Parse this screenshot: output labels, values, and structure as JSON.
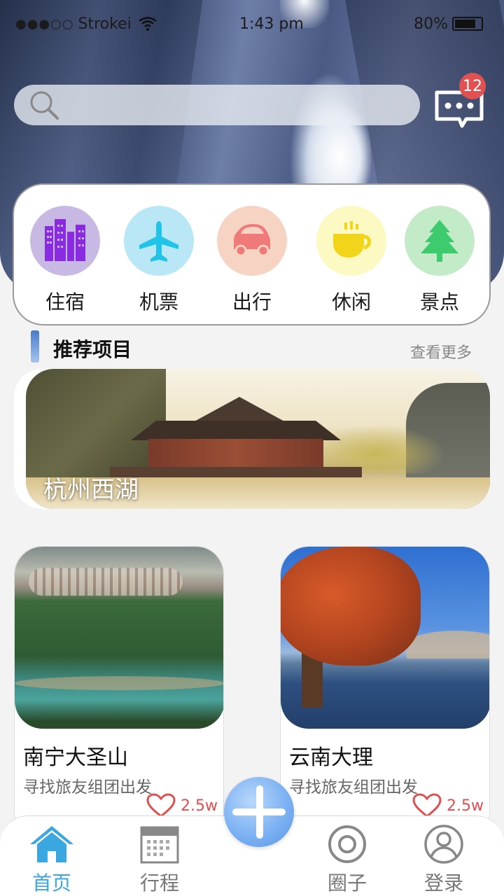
{
  "status_bar": {
    "signal": "●●●○○",
    "carrier": "Strokei",
    "time": "1:43 pm",
    "battery": "80%"
  },
  "search": {
    "placeholder": ""
  },
  "messages": {
    "badge": "12"
  },
  "categories": [
    {
      "label": "住宿",
      "icon": "building-icon",
      "bg": "#c7b8e4",
      "color": "#8a2be2"
    },
    {
      "label": "机票",
      "icon": "airplane-icon",
      "bg": "#b9e7f5",
      "color": "#1fc4e8"
    },
    {
      "label": "出行",
      "icon": "car-icon",
      "bg": "#f7d3c3",
      "color": "#f07a7a"
    },
    {
      "label": "休闲",
      "icon": "coffee-icon",
      "bg": "#fcf9c2",
      "color": "#f2d51a"
    },
    {
      "label": "景点",
      "icon": "tree-icon",
      "bg": "#c4ebc7",
      "color": "#3ecb6d"
    }
  ],
  "section": {
    "title": "推荐项目",
    "more": "查看更多"
  },
  "featured": {
    "title": "杭州西湖"
  },
  "destinations": [
    {
      "name": "南宁大圣山",
      "subtitle": "寻找旅友组团出发",
      "likes": "2.5w"
    },
    {
      "name": "云南大理",
      "subtitle": "寻找旅友组团出发",
      "likes": "2.5w"
    }
  ],
  "tabs": [
    {
      "label": "首页",
      "icon": "home-icon",
      "active": true
    },
    {
      "label": "行程",
      "icon": "calendar-icon",
      "active": false
    },
    {
      "label": "圈子",
      "icon": "circle-target-icon",
      "active": false
    },
    {
      "label": "登录",
      "icon": "user-icon",
      "active": false
    }
  ],
  "colors": {
    "accent": "#3aa7e0",
    "like": "#e05050",
    "badge": "#e25151"
  }
}
